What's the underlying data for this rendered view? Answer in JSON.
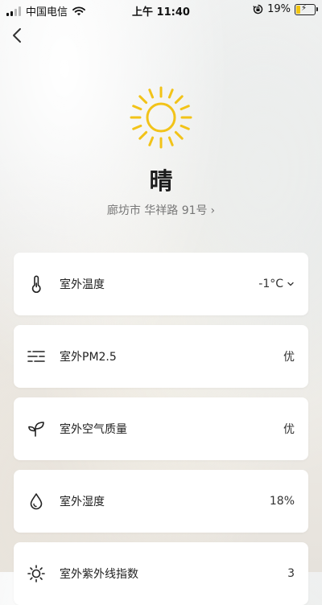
{
  "status_bar": {
    "carrier": "中国电信",
    "time": "上午 11:40",
    "battery": "19%"
  },
  "weather": {
    "icon": "sun-icon",
    "condition": "晴",
    "location": "廊坊市 华祥路 91号",
    "icon_color": "#f2c318"
  },
  "cards": [
    {
      "icon": "thermometer-icon",
      "label": "室外温度",
      "value": "-1°C",
      "has_dropdown": true
    },
    {
      "icon": "pm25-icon",
      "label": "室外PM2.5",
      "value": "优"
    },
    {
      "icon": "sprout-icon",
      "label": "室外空气质量",
      "value": "优"
    },
    {
      "icon": "water-drop-icon",
      "label": "室外湿度",
      "value": "18%"
    },
    {
      "icon": "uv-sun-icon",
      "label": "室外紫外线指数",
      "value": "3"
    }
  ]
}
